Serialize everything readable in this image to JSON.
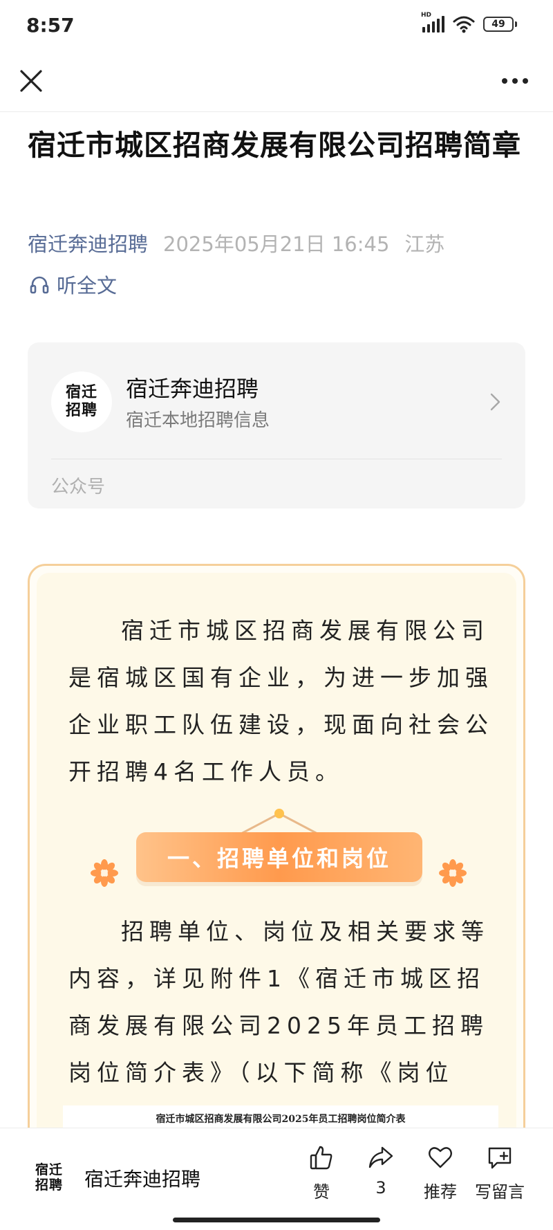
{
  "status_bar": {
    "time": "8:57",
    "network_label": "HD",
    "battery": "49"
  },
  "nav": {
    "close_icon": "close-icon",
    "more_icon": "more-icon"
  },
  "article": {
    "title": "宿迁市城区招商发展有限公司招聘简章",
    "account": "宿迁奔迪招聘",
    "date": "2025年05月21日 16:45",
    "location": "江苏",
    "listen_label": "听全文"
  },
  "account_card": {
    "logo_line1": "宿迁",
    "logo_line2": "招聘",
    "name": "宿迁奔迪招聘",
    "description": "宿迁本地招聘信息",
    "type": "公众号"
  },
  "content": {
    "intro": "宿迁市城区招商发展有限公司是宿城区国有企业，为进一步加强企业职工队伍建设，现面向社会公开招聘4名工作人员。",
    "section1_title": "一、招聘单位和岗位",
    "section1_body": "招聘单位、岗位及相关要求等内容，详见附件1《宿迁市城区招商发展有限公司2025年员工招聘岗位简介表》（以下简称《岗位表》）。",
    "table_caption": "宿迁市城区招商发展有限公司2025年员工招聘岗位简介表"
  },
  "bottom_bar": {
    "account_name": "宿迁奔迪招聘",
    "like_label": "赞",
    "share_count": "3",
    "recommend_label": "推荐",
    "comment_label": "写留言"
  },
  "colors": {
    "link_blue": "#576b95",
    "frame_border": "#f5cf9a",
    "pill_orange": "#ff9a4d"
  }
}
